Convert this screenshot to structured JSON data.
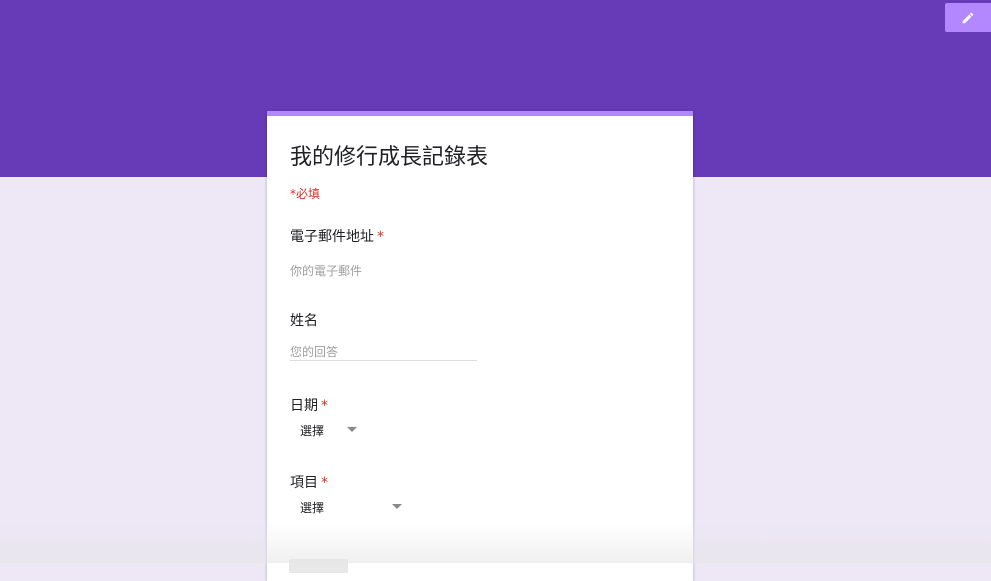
{
  "theme": {
    "header_color": "#673ab7",
    "background_color": "#ede7f6",
    "accent_color": "#b388ff",
    "required_color": "#d93025"
  },
  "toolbar": {
    "edit_icon": "pencil-icon"
  },
  "form": {
    "title": "我的修行成長記錄表",
    "required_note": "*必填",
    "questions": [
      {
        "label": "電子郵件地址",
        "required_mark": "*",
        "placeholder": "你的電子郵件"
      },
      {
        "label": "姓名",
        "placeholder": "您的回答"
      },
      {
        "label": "日期",
        "required_mark": "*",
        "selected": "選擇"
      },
      {
        "label": "項目",
        "required_mark": "*",
        "selected": "選擇"
      }
    ]
  }
}
